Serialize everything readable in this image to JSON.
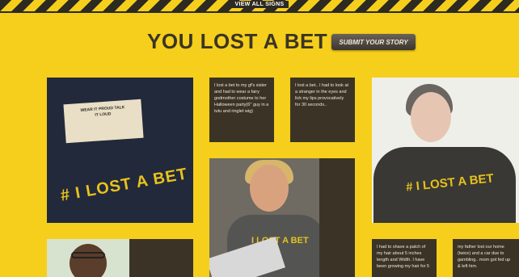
{
  "header": {
    "view_all": "VIEW ALL SIGNS"
  },
  "main": {
    "title": "YOU LOST A BET",
    "submit_label": "SUBMIT YOUR STORY"
  },
  "tiles": {
    "shirt_photo": {
      "card_text": "WEAR IT PROUD TALK IT LOUD",
      "shirt_text": "# I LOST A BET"
    },
    "story1": "I lost a bet to my gf's sister and had to wear a fairy godmother costume to her Halloween party(6'' guy in a tutu and ringlet wig)",
    "story2": "I lost a bet.. I had to look at a stranger in the eyes and lick my lips provocatively for 30 seconds..",
    "guitar_photo": {
      "shirt_text": "I LOST A BET"
    },
    "woman_photo": {
      "shirt_text": "# I LOST A BET"
    },
    "story3": "I had to shave a patch of my hair about 5 inches length and Width. I have been growing my hair for 5",
    "story4": "my father lost our home (twice) and a car due to gambling.. mom got fed up & left him."
  }
}
